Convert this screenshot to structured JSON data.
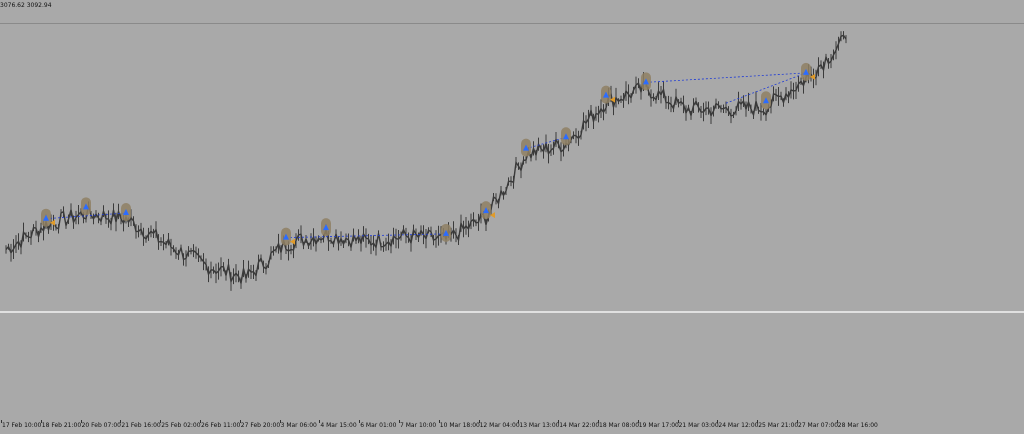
{
  "header": {
    "quote": "3076.62 3092.94"
  },
  "colors": {
    "background": "#a9a9a9",
    "price_line": "#3a3a3a",
    "highlight": "#8f8064",
    "trade_line": "#1f3bd6",
    "separator": "#e0e0e0",
    "up_marker": "#2b6cff",
    "down_marker": "#e09b2a",
    "axis_text": "#111111"
  },
  "chart_data": {
    "type": "line",
    "title": "",
    "x": [
      "17 Feb 10:00",
      "18 Feb 21:00",
      "20 Feb 07:00",
      "21 Feb 16:00",
      "25 Feb 02:00",
      "26 Feb 11:00",
      "27 Feb 20:00",
      "3 Mar 06:00",
      "4 Mar 15:00",
      "6 Mar 01:00",
      "7 Mar 10:00",
      "10 Mar 18:00",
      "12 Mar 04:00",
      "13 Mar 13:00",
      "14 Mar 22:00",
      "18 Mar 08:00",
      "19 Mar 17:00",
      "21 Mar 03:00",
      "24 Mar 12:00",
      "25 Mar 21:00",
      "27 Mar 07:00",
      "28 Mar 16:00"
    ],
    "series": [
      {
        "values": [
          2862,
          2888,
          2900,
          2894,
          2868,
          2845,
          2832,
          2868,
          2878,
          2870,
          2876,
          2872,
          2896,
          2962,
          2974,
          3018,
          3032,
          3010,
          3010,
          3012,
          3042,
          3084
        ]
      }
    ],
    "xlabel": "",
    "ylabel": "",
    "ylim": [
      2800,
      3100
    ],
    "grid": false,
    "legend": "none"
  },
  "axis": {
    "labels": [
      "17 Feb 10:00",
      "18 Feb 21:00",
      "20 Feb 07:00",
      "21 Feb 16:00",
      "25 Feb 02:00",
      "26 Feb 11:00",
      "27 Feb 20:00",
      "3 Mar 06:00",
      "4 Mar 15:00",
      "6 Mar 01:00",
      "7 Mar 10:00",
      "10 Mar 18:00",
      "12 Mar 04:00",
      "13 Mar 13:00",
      "14 Mar 22:00",
      "18 Mar 08:00",
      "19 Mar 17:00",
      "21 Mar 03:00",
      "24 Mar 12:00",
      "25 Mar 21:00",
      "27 Mar 07:00",
      "28 Mar 16:00"
    ]
  }
}
